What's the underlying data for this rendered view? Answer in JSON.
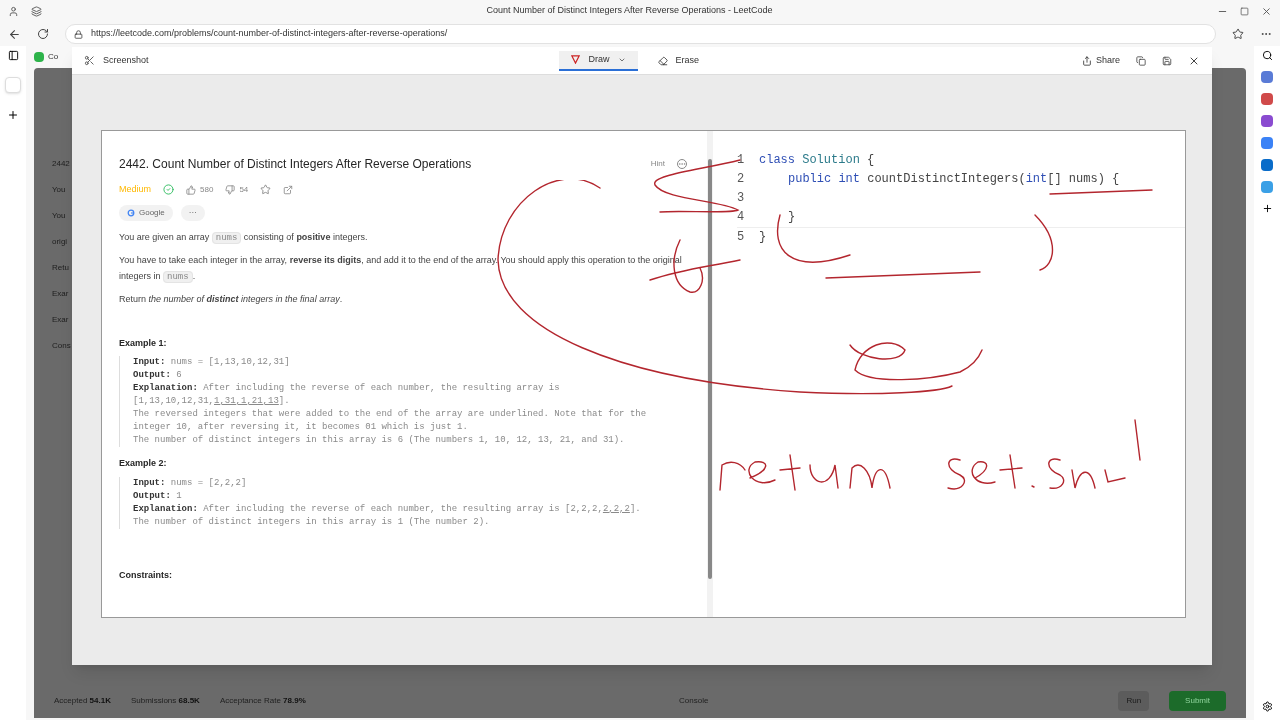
{
  "browser": {
    "tab_title": "Count Number of Distinct Integers After Reverse Operations - LeetCode",
    "url": "https://leetcode.com/problems/count-number-of-distinct-integers-after-reverse-operations/",
    "bookmark": "Co"
  },
  "screenshot_tool": {
    "title": "Screenshot",
    "tools": [
      {
        "label": "Draw",
        "selected": true
      },
      {
        "label": "Erase",
        "selected": false
      }
    ],
    "share": "Share"
  },
  "problem": {
    "title": "2442. Count Number of Distinct Integers After Reverse Operations",
    "hint": "Hint",
    "difficulty": "Medium",
    "likes": "580",
    "dislikes": "54",
    "company": "Google",
    "more": "···",
    "paragraphs": [
      [
        {
          "kind": "text",
          "text": "You are given an array "
        },
        {
          "kind": "code",
          "text": "nums"
        },
        {
          "kind": "text",
          "text": " consisting of **positive** integers."
        }
      ],
      [
        {
          "kind": "text",
          "text": "You have to take each integer in the array, **reverse its digits**, and add it to the end of the array. You should apply this operation to the original integers in "
        },
        {
          "kind": "code",
          "text": "nums"
        },
        {
          "kind": "text",
          "text": "."
        }
      ],
      [
        {
          "kind": "text",
          "text": "Return "
        },
        {
          "kind": "italic",
          "text": "the number of **distinct** integers in the final array"
        },
        {
          "kind": "text",
          "text": "."
        }
      ]
    ],
    "examples": [
      {
        "heading": "Example 1:",
        "lines": [
          [
            {
              "kind": "label",
              "text": "Input:"
            },
            {
              "kind": "muted",
              "text": " nums = [1,13,10,12,31]"
            }
          ],
          [
            {
              "kind": "label",
              "text": "Output:"
            },
            {
              "kind": "muted",
              "text": " 6"
            }
          ],
          [
            {
              "kind": "label",
              "text": "Explanation:"
            },
            {
              "kind": "muted",
              "text": " After including the reverse of each number, the resulting array is"
            }
          ],
          [
            {
              "kind": "muted",
              "text": "[1,13,10,12,31,"
            },
            {
              "kind": "underlined",
              "text": "1,31,1,21,13"
            },
            {
              "kind": "muted",
              "text": "]."
            }
          ],
          [
            {
              "kind": "muted",
              "text": "The reversed integers that were added to the end of the array are underlined. Note that for the"
            }
          ],
          [
            {
              "kind": "muted",
              "text": "integer 10, after reversing it, it becomes 01 which is just 1."
            }
          ],
          [
            {
              "kind": "muted",
              "text": "The number of distinct integers in this array is 6 (The numbers 1, 10, 12, 13, 21, and 31)."
            }
          ]
        ]
      },
      {
        "heading": "Example 2:",
        "lines": [
          [
            {
              "kind": "label",
              "text": "Input:"
            },
            {
              "kind": "muted",
              "text": " nums = [2,2,2]"
            }
          ],
          [
            {
              "kind": "label",
              "text": "Output:"
            },
            {
              "kind": "muted",
              "text": " 1"
            }
          ],
          [
            {
              "kind": "label",
              "text": "Explanation:"
            },
            {
              "kind": "muted",
              "text": " After including the reverse of each number, the resulting array is [2,2,2,"
            },
            {
              "kind": "underlined",
              "text": "2,2,2"
            },
            {
              "kind": "muted",
              "text": "]."
            }
          ],
          [
            {
              "kind": "muted",
              "text": "The number of distinct integers in this array is 1 (The number 2)."
            }
          ]
        ]
      }
    ],
    "constraints_heading": "Constraints:"
  },
  "editor": {
    "lines": [
      {
        "number": "1",
        "tokens": [
          {
            "kind": "keyword",
            "text": "class "
          },
          {
            "kind": "type",
            "text": "Solution"
          },
          {
            "kind": "plain",
            "text": " {"
          }
        ]
      },
      {
        "number": "2",
        "tokens": [
          {
            "kind": "keyword",
            "text": "public int "
          },
          {
            "kind": "plain",
            "text": "countDistinctIntegers("
          },
          {
            "kind": "keyword",
            "text": "int"
          },
          {
            "kind": "plain",
            "text": "[] nums) {"
          }
        ]
      },
      {
        "number": "3"
      },
      {
        "number": "4",
        "tokens": [
          {
            "kind": "plain",
            "text": "}"
          }
        ]
      },
      {
        "number": "5",
        "tokens": [
          {
            "kind": "plain",
            "text": "}"
          }
        ]
      }
    ]
  },
  "background": {
    "left_fragments": [
      "2442",
      "You",
      "You",
      "origi",
      "Retu",
      "Exar",
      "Exar",
      "Cons"
    ],
    "stats": [
      {
        "label": "Accepted",
        "value": "54.1K"
      },
      {
        "label": "Submissions",
        "value": "68.5K"
      },
      {
        "label": "Acceptance Rate",
        "value": "78.9%"
      }
    ],
    "console": "Console",
    "run": "Run",
    "submit": "Submit"
  }
}
